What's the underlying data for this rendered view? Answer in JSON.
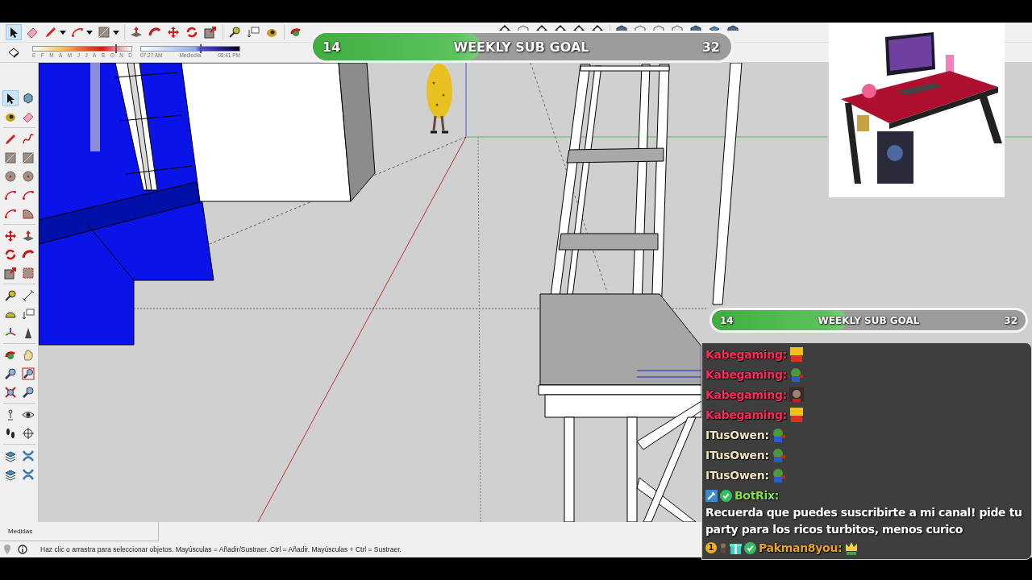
{
  "toolbar": {
    "tools": [
      {
        "selected": true
      },
      {
        "selected": false
      },
      {
        "selected": false
      },
      {
        "selected": false
      },
      {
        "selected": false
      },
      {
        "selected": false
      },
      {
        "selected": false
      },
      {
        "selected": false
      },
      {
        "selected": false
      },
      {
        "selected": false
      },
      {
        "selected": false
      },
      {
        "selected": false
      },
      {
        "selected": false
      },
      {
        "selected": false
      },
      {
        "selected": false
      },
      {
        "selected": false
      },
      {
        "selected": false
      }
    ]
  },
  "shadow_settings": {
    "date_slider": {
      "level": 0.84,
      "months": [
        "E",
        "F",
        "M",
        "A",
        "M",
        "J",
        "J",
        "A",
        "S",
        "O",
        "N",
        "D"
      ]
    },
    "time_slider": {
      "level": 0.6,
      "labels": [
        "07:27 AM",
        "Mediodía",
        "05:41 PM"
      ]
    }
  },
  "left_toolbar": {
    "tools": [
      {
        "selected": true
      },
      {
        "selected": false
      },
      {
        "selected": false
      },
      {
        "selected": false
      },
      {
        "selected": false
      },
      {
        "selected": false
      },
      {
        "selected": false
      },
      {
        "selected": false
      },
      {
        "selected": false
      },
      {
        "selected": false
      },
      {
        "selected": false
      },
      {
        "selected": false
      },
      {
        "selected": false
      },
      {
        "selected": false
      },
      {
        "selected": false
      },
      {
        "selected": false
      },
      {
        "selected": false
      },
      {
        "selected": false
      },
      {
        "selected": false
      },
      {
        "selected": false
      },
      {
        "selected": false
      },
      {
        "selected": false
      },
      {
        "selected": false
      },
      {
        "selected": false
      },
      {
        "selected": false
      },
      {
        "selected": false
      },
      {
        "selected": false
      },
      {
        "selected": false
      },
      {
        "selected": false
      },
      {
        "selected": false
      },
      {
        "selected": false
      },
      {
        "selected": false
      },
      {
        "selected": false
      },
      {
        "selected": false
      },
      {
        "selected": false
      },
      {
        "selected": false
      },
      {
        "selected": false
      },
      {
        "selected": false
      },
      {
        "selected": false
      },
      {
        "selected": false
      }
    ]
  },
  "goal_bars": [
    {
      "kind": "large",
      "start": "14",
      "title": "WEEKLY SUB GOAL",
      "end": "32",
      "level": 0.4
    },
    {
      "kind": "small",
      "start": "14",
      "title": "WEEKLY SUB GOAL",
      "end": "32",
      "level": 0.43
    }
  ],
  "chat": {
    "messages": [
      {
        "user": "Kabegaming:",
        "color": "#ff2a5c",
        "emote": {
          "kind": "sign"
        }
      },
      {
        "user": "Kabegaming:",
        "color": "#ff2a5c",
        "emote": {
          "kind": "frog"
        }
      },
      {
        "user": "Kabegaming:",
        "color": "#ff2a5c"
      },
      {
        "user": "Kabegaming:",
        "color": "#ff2a5c",
        "emote": {
          "kind": "sign"
        }
      },
      {
        "user": "ITusOwen:",
        "color": "#efe3c0",
        "emote": {
          "kind": "frog"
        }
      },
      {
        "user": "ITusOwen:",
        "color": "#efe3c0",
        "emote": {
          "kind": "frog"
        }
      },
      {
        "user": "ITusOwen:",
        "color": "#efe3c0",
        "emote": {
          "kind": "frog"
        }
      },
      {
        "user": "BotRix:",
        "color": "#86e04a",
        "badges": [
          {
            "kind": "mod"
          },
          {
            "kind": "verified"
          }
        ],
        "text": "Recuerda que puedes suscribirte a mi canal! pide tu party para los ricos turbitos, menos curico"
      },
      {
        "user": "Pakman8you:",
        "color": "#e6a52a",
        "badges": [
          {
            "kind": "count",
            "label": "1"
          },
          {
            "kind": "figure"
          },
          {
            "kind": "gift"
          },
          {
            "kind": "verified"
          }
        ],
        "emote": {
          "kind": "crown"
        }
      }
    ]
  },
  "status_bar": {
    "measurements_label": "Medidas",
    "hint": "Haz clic o arrastra para seleccionar objetos. Mayúsculas = Añadir/Sustraer. Ctrl = Añadir. Mayúsculas + Ctrl = Sustraer."
  }
}
